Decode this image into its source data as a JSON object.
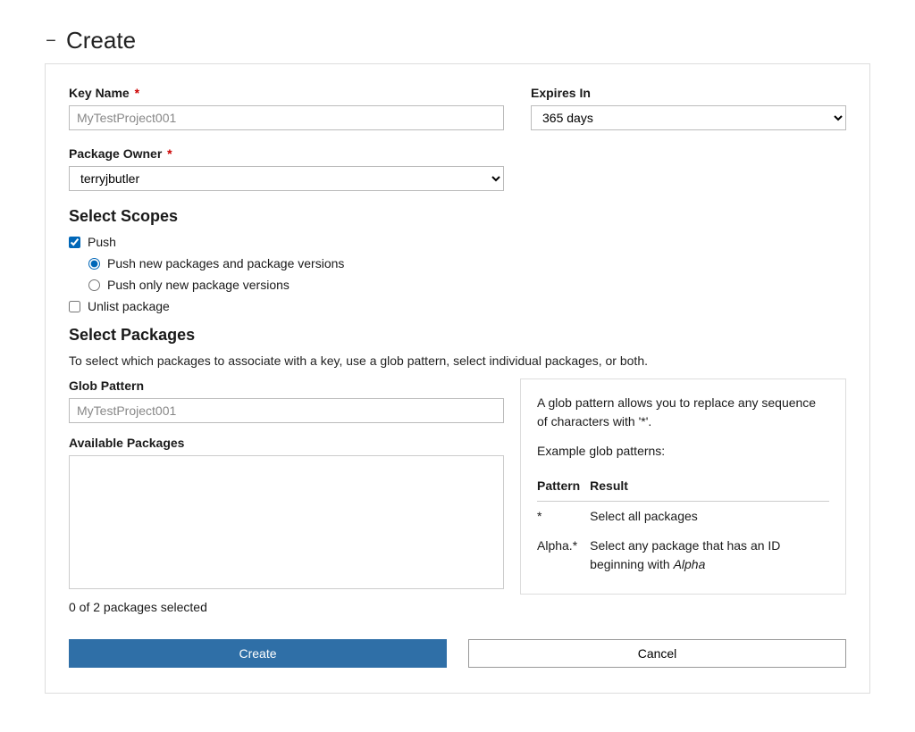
{
  "header": {
    "title": "Create"
  },
  "fields": {
    "key_name": {
      "label": "Key Name",
      "placeholder": "MyTestProject001",
      "required_marker": "*"
    },
    "expires_in": {
      "label": "Expires In",
      "value": "365 days"
    },
    "package_owner": {
      "label": "Package Owner",
      "value": "terryjbutler",
      "required_marker": "*"
    },
    "glob_pattern": {
      "label": "Glob Pattern",
      "placeholder": "MyTestProject001"
    },
    "available_packages": {
      "label": "Available Packages"
    }
  },
  "scopes": {
    "heading": "Select Scopes",
    "push": "Push",
    "push_new": "Push new packages and package versions",
    "push_only": "Push only new package versions",
    "unlist": "Unlist package"
  },
  "packages": {
    "heading": "Select Packages",
    "description": "To select which packages to associate with a key, use a glob pattern, select individual packages, or both.",
    "selected_text": "0 of 2 packages selected"
  },
  "info": {
    "intro": "A glob pattern allows you to replace any sequence of characters with '*'.",
    "example_label": "Example glob patterns:",
    "table": {
      "col_pattern": "Pattern",
      "col_result": "Result",
      "rows": [
        {
          "pattern": "*",
          "result_pre": "Select all packages",
          "result_em": ""
        },
        {
          "pattern": "Alpha.*",
          "result_pre": "Select any package that has an ID beginning with ",
          "result_em": "Alpha"
        }
      ]
    }
  },
  "buttons": {
    "create": "Create",
    "cancel": "Cancel"
  }
}
